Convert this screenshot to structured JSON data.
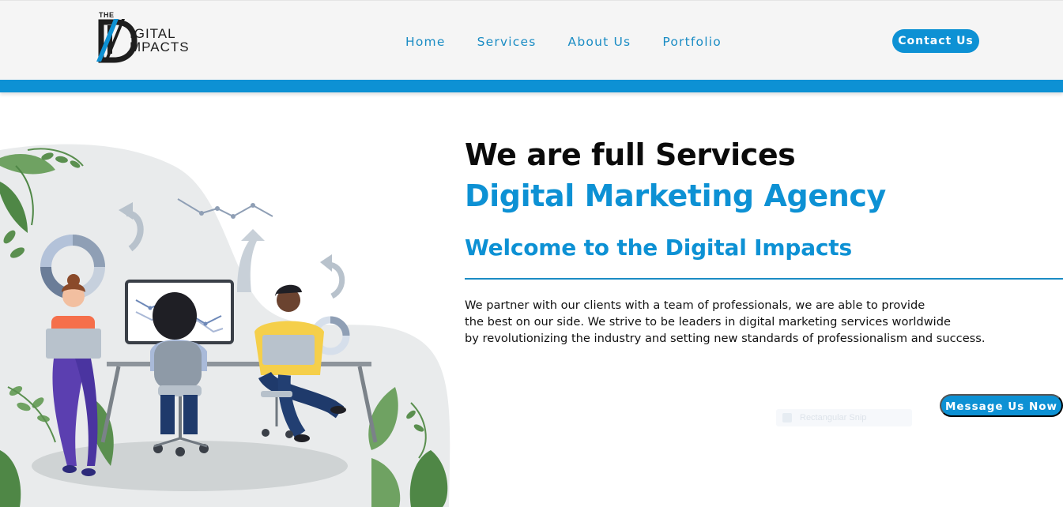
{
  "brand": {
    "small": "THE",
    "line1": "IGITAL",
    "line2": "MPACTS",
    "colors": {
      "primary": "#0d91d4",
      "dark": "#1e1e1e"
    }
  },
  "nav": {
    "items": [
      "Home",
      "Services",
      "About Us",
      "Portfolio"
    ],
    "contact_label": "Contact Us"
  },
  "hero": {
    "title": "We are full Services",
    "subtitle": "Digital Marketing Agency",
    "welcome": "Welcome to the Digital Impacts",
    "paragraph_lines": [
      "We partner with our clients with a team of professionals, we are able to provide",
      "the best on our side. We strive to be leaders in digital marketing services worldwide",
      "by revolutionizing the industry and setting new standards of professionalism and success."
    ]
  },
  "message_button": "Message Us Now",
  "ghost_overlay": "Rectangular Snip",
  "illustration": {
    "icons": [
      "leaf-icon",
      "donut-chart-icon",
      "refresh-arrow-icon",
      "trend-line-icon",
      "up-arrow-icon",
      "monitor-chart-icon",
      "laptop-icon"
    ]
  }
}
